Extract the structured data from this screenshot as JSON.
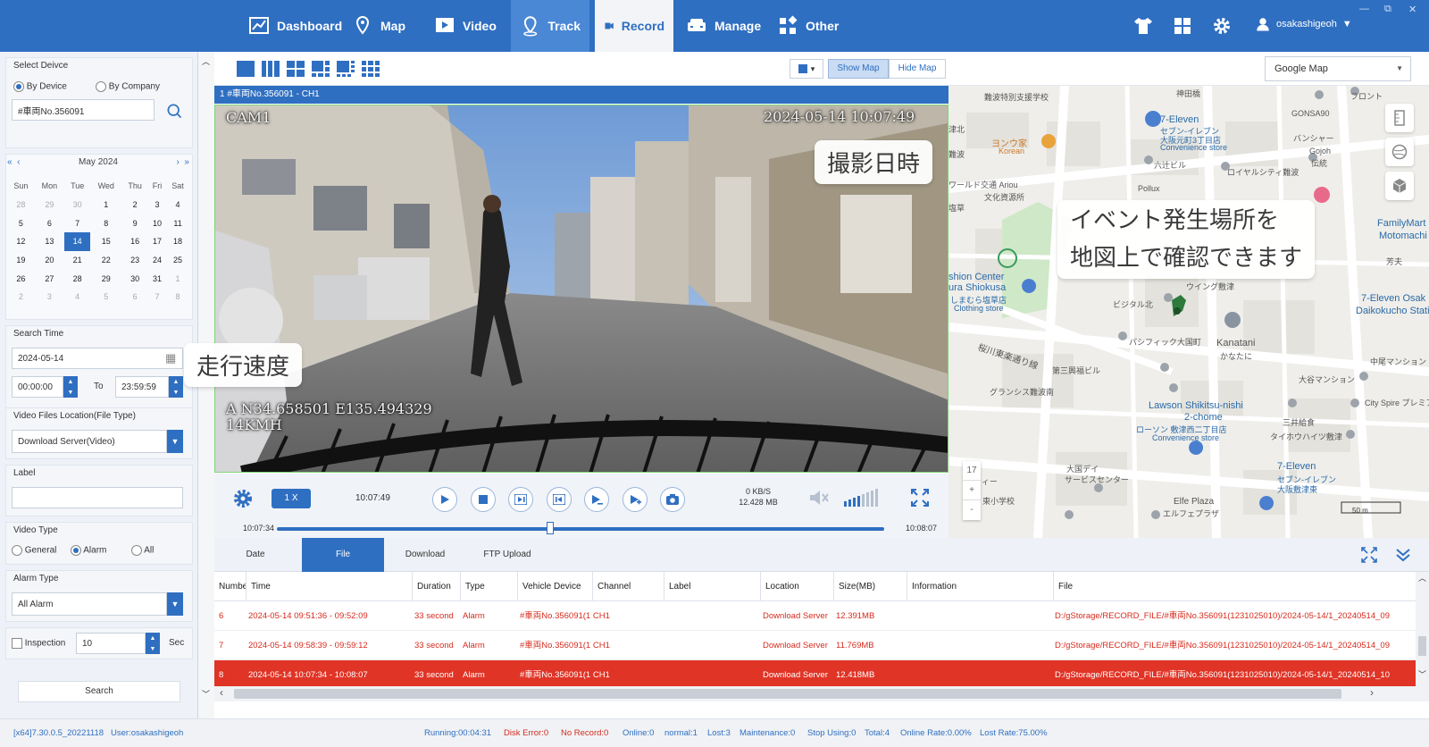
{
  "nav": {
    "items": [
      {
        "label": "Dashboard",
        "icon": "chart-icon"
      },
      {
        "label": "Map",
        "icon": "map-pin-icon"
      },
      {
        "label": "Video",
        "icon": "video-icon"
      },
      {
        "label": "Track",
        "icon": "location-icon"
      },
      {
        "label": "Record",
        "icon": "record-icon"
      },
      {
        "label": "Manage",
        "icon": "car-icon"
      },
      {
        "label": "Other",
        "icon": "grid-icon"
      }
    ],
    "active_item": "Record",
    "user": "osakashigeoh",
    "accent": "#2f6fc1"
  },
  "left": {
    "select_device_title": "Select Deivce",
    "by_device": "By Device",
    "by_company": "By Company",
    "device_value": "#車両No.356091",
    "calendar": {
      "month": "May 2024",
      "weekdays": [
        "Sun",
        "Mon",
        "Tue",
        "Wed",
        "Thu",
        "Fri",
        "Sat"
      ],
      "weeks": [
        [
          "28",
          "29",
          "30",
          "1",
          "2",
          "3",
          "4"
        ],
        [
          "5",
          "6",
          "7",
          "8",
          "9",
          "10",
          "11"
        ],
        [
          "12",
          "13",
          "14",
          "15",
          "16",
          "17",
          "18"
        ],
        [
          "19",
          "20",
          "21",
          "22",
          "23",
          "24",
          "25"
        ],
        [
          "26",
          "27",
          "28",
          "29",
          "30",
          "31",
          "1"
        ],
        [
          "2",
          "3",
          "4",
          "5",
          "6",
          "7",
          "8"
        ]
      ],
      "selected": "14"
    },
    "search_time_label": "Search Time",
    "date_value": "2024-05-14",
    "time_from": "00:00:00",
    "to_label": "To",
    "time_to": "23:59:59",
    "file_location_label": "Video Files Location(File Type)",
    "file_location_value": "Download Server(Video)",
    "label_label": "Label",
    "video_type_label": "Video Type",
    "video_types": [
      "General",
      "Alarm",
      "All"
    ],
    "video_type_selected": "Alarm",
    "alarm_type_label": "Alarm Type",
    "alarm_type_value": "All Alarm",
    "inspection_label": "Inspection",
    "inspection_value": "10",
    "sec_label": "Sec",
    "search_button": "Search"
  },
  "video": {
    "show_map": "Show Map",
    "hide_map": "Hide Map",
    "channel_title": "1  #車両No.356091 - CH1",
    "cam_label": "CAM1",
    "timestamp_overlay": "2024-05-14 10:07:49",
    "gps_overlay": "A N34.658501 E135.494329",
    "speed_overlay": "14KMH",
    "callout_time": "撮影日時",
    "callout_speed": "走行速度",
    "speed_rate": "1 X",
    "current_time": "10:07:49",
    "bitrate": "0 KB/S",
    "size": "12.428 MB",
    "range_start": "10:07:34",
    "range_end": "10:08:07",
    "progress": 0.45
  },
  "map": {
    "provider": "Google Map",
    "callout_line1": "イベント発生場所を",
    "callout_line2": "地図上で確認できます",
    "zoom_level": "17",
    "scale": "50 m",
    "labels": {
      "l1": "難波特別支援学校",
      "l2": "神田橋",
      "l3": "7-Eleven",
      "l4": "セブン-イレブン",
      "l5": "大阪元町3丁目店",
      "l6": "Convenience store",
      "l7": "ヨンウ家",
      "l8": "Korean",
      "l9": "六辻ビル",
      "l10": "ロイヤルシティ難波",
      "l11": "Pollux",
      "l12": "GONSA90",
      "l13": "バンシャー",
      "l14": "FamilyMart N",
      "l15": "Motomachi 3-",
      "l16": "shion Center",
      "l17": "ura Shiokusa",
      "l18": "しまむら塩草店",
      "l19": "Clothing store",
      "l20": "ウイング敷津",
      "l21": "ビジタル北",
      "l22": "パシフィック大国町",
      "l23": "Kanatani",
      "l24": "かなたに",
      "l25": "7-Eleven Osak",
      "l26": "Daikokucho Station",
      "l27": "桜川東楽通り線",
      "l28": "第三興福ビル",
      "l29": "中尾マンション",
      "l30": "大谷マンション",
      "l31": "グランシス難波南",
      "l32": "Lawson Shikitsu-nishi",
      "l33": "2-chome",
      "l34": "ローソン 敷津西二丁目店",
      "l35": "Convenience store",
      "l36": "City Spire プレミア",
      "l37": "三井給食",
      "l38": "タイホウハイツ敷津",
      "l39": "大国デイ",
      "l40": "サービスセンター",
      "l41": "Elfe Plaza",
      "l42": "エルフェプラザ",
      "l43": "7-Eleven",
      "l44": "セブン-イレブン",
      "l45": "大阪敷津東",
      "l46": "ワールド交通 Ariou",
      "l47": "文化資源所",
      "l48": "フロント",
      "l49": "Gojoh",
      "l50": "伝統",
      "l51": "フィー",
      "l52": "芳夫",
      "l53": "津北",
      "l54": "難波",
      "l55": "塩草",
      "l56": "東小学校"
    }
  },
  "tabs": [
    "Date",
    "File",
    "Download",
    "FTP Upload"
  ],
  "active_tab": "File",
  "table": {
    "headers": [
      "Numbe",
      "Time",
      "Duration",
      "Type",
      "Vehicle Device",
      "Channel",
      "Label",
      "Location",
      "Size(MB)",
      "Information",
      "File"
    ],
    "rows": [
      {
        "num": "6",
        "time": "2024-05-14 09:51:36 - 09:52:09",
        "duration": "33 second",
        "type": "Alarm",
        "device": "#車両No.356091(1 CH1",
        "channel": "",
        "label": "",
        "location": "Download Server",
        "size": "12.391MB",
        "info": "",
        "file": "D:/gStorage/RECORD_FILE/#車両No.356091(1231025010)/2024-05-14/1_20240514_09"
      },
      {
        "num": "7",
        "time": "2024-05-14 09:58:39 - 09:59:12",
        "duration": "33 second",
        "type": "Alarm",
        "device": "#車両No.356091(1 CH1",
        "channel": "",
        "label": "",
        "location": "Download Server",
        "size": "11.769MB",
        "info": "",
        "file": "D:/gStorage/RECORD_FILE/#車両No.356091(1231025010)/2024-05-14/1_20240514_09"
      },
      {
        "num": "8",
        "time": "2024-05-14 10:07:34 - 10:08:07",
        "duration": "33 second",
        "type": "Alarm",
        "device": "#車両No.356091(1 CH1",
        "channel": "",
        "label": "",
        "location": "Download Server",
        "size": "12.418MB",
        "info": "",
        "file": "D:/gStorage/RECORD_FILE/#車両No.356091(1231025010)/2024-05-14/1_20240514_10"
      }
    ],
    "selected_row": "8"
  },
  "status": {
    "version": "[x64]7.30.0.5_20221118",
    "user": "User:osakashigeoh",
    "running": "Running:00:04:31",
    "disk_error": "Disk Error:0",
    "no_record": "No Record:0",
    "online": "Online:0",
    "normal": "normal:1",
    "lost": "Lost:3",
    "maintenance": "Maintenance:0",
    "stop_using": "Stop Using:0",
    "total": "Total:4",
    "online_rate": "Online Rate:0.00%",
    "lost_rate": "Lost Rate:75.00%"
  }
}
